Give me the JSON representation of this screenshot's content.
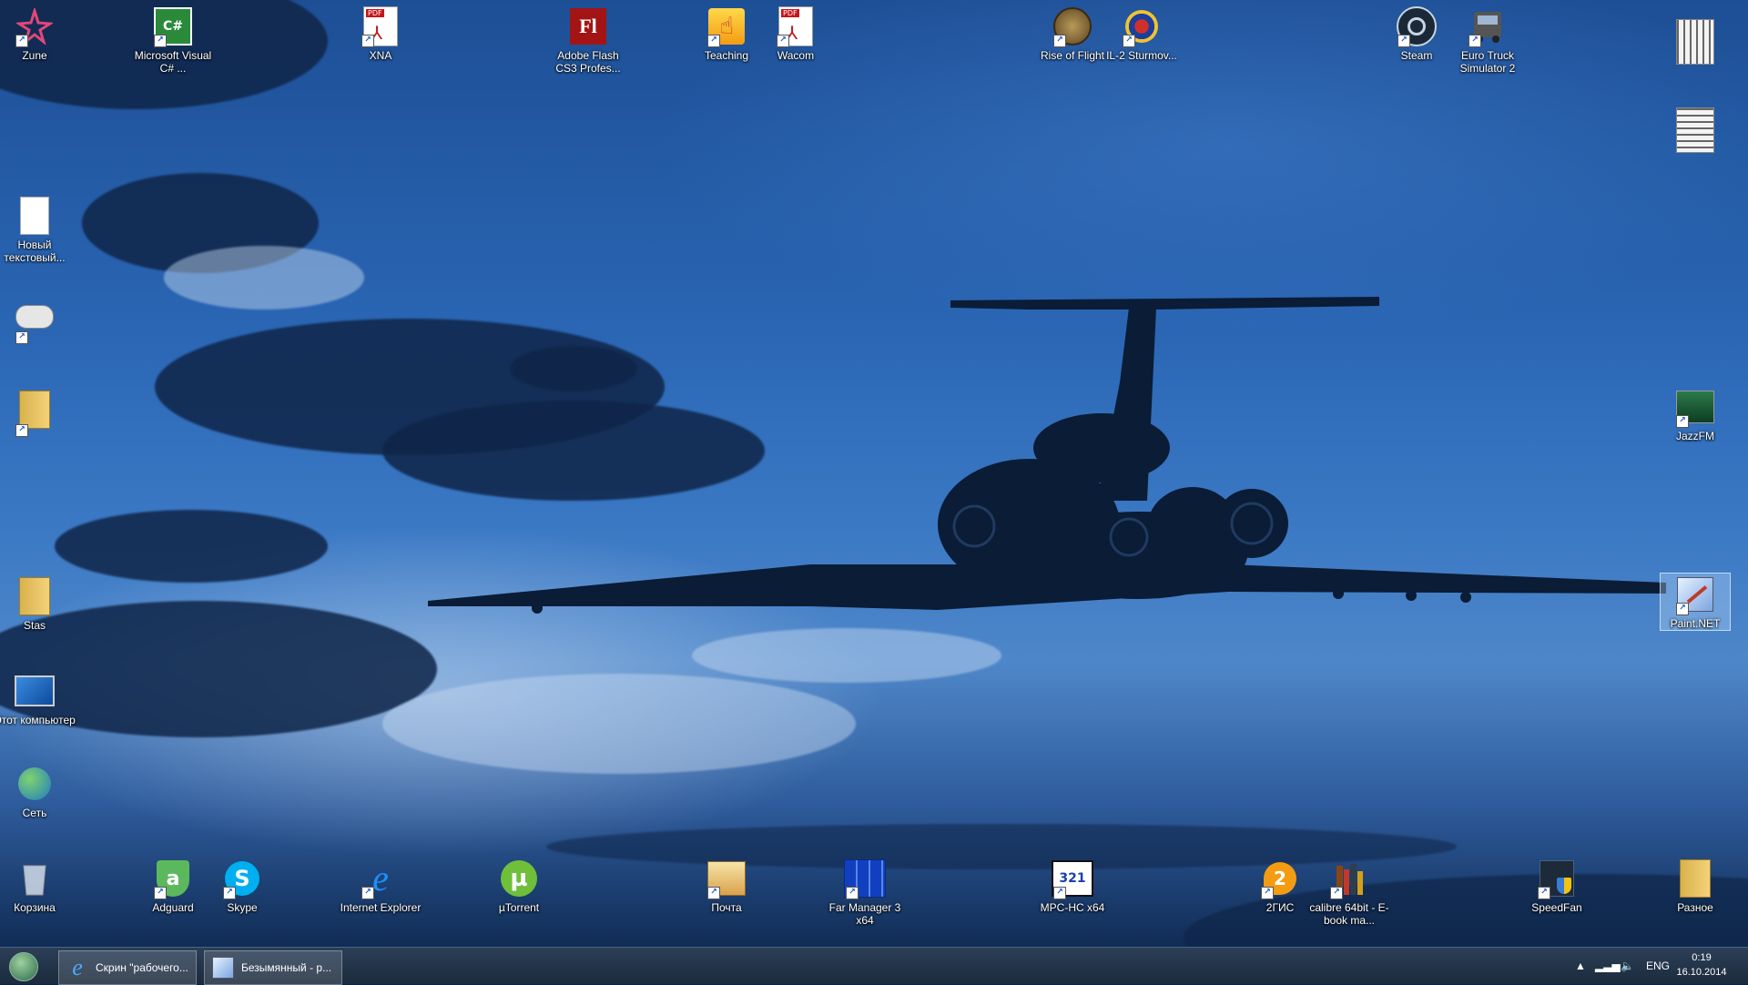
{
  "desktop": {
    "icons": {
      "zune": "Zune",
      "vcsharp": "Microsoft Visual C# ...",
      "xna": "XNA",
      "flash": "Adobe Flash CS3 Profes...",
      "teaching": "Teaching",
      "wacom": "Wacom",
      "rise": "Rise of Flight",
      "il2": "IL-2 Sturmov...",
      "steam": "Steam",
      "ets2": "Euro Truck Simulator 2",
      "newtext": "Новый текстовый...",
      "stas": "Stas",
      "computer": "Этот компьютер",
      "network": "Сеть",
      "recycle": "Корзина",
      "adguard": "Adguard",
      "skype": "Skype",
      "ie": "Internet Explorer",
      "utorrent": "µTorrent",
      "mail": "Почта",
      "far": "Far Manager 3 x64",
      "mpc": "MPC-HC x64",
      "gis": "2ГИС",
      "calibre": "calibre 64bit - E-book ma...",
      "speedfan": "SpeedFan",
      "raznoe": "Разное",
      "jazzfm": "JazzFM",
      "paintnet": "Paint.NET"
    },
    "icon_glyphs": {
      "vcsharp": "C#",
      "xna": "PDF",
      "flash": "Fl",
      "wacom": "PDF",
      "skype": "S",
      "ie": "e",
      "utorrent": "µ",
      "mpc": "321",
      "gis": "2",
      "adguard": "a"
    }
  },
  "taskbar": {
    "buttons": [
      {
        "label": "Скрин \"рабочего..."
      },
      {
        "label": "Безымянный - р..."
      }
    ],
    "language": "ENG",
    "time": "0:19",
    "date": "16.10.2014"
  }
}
